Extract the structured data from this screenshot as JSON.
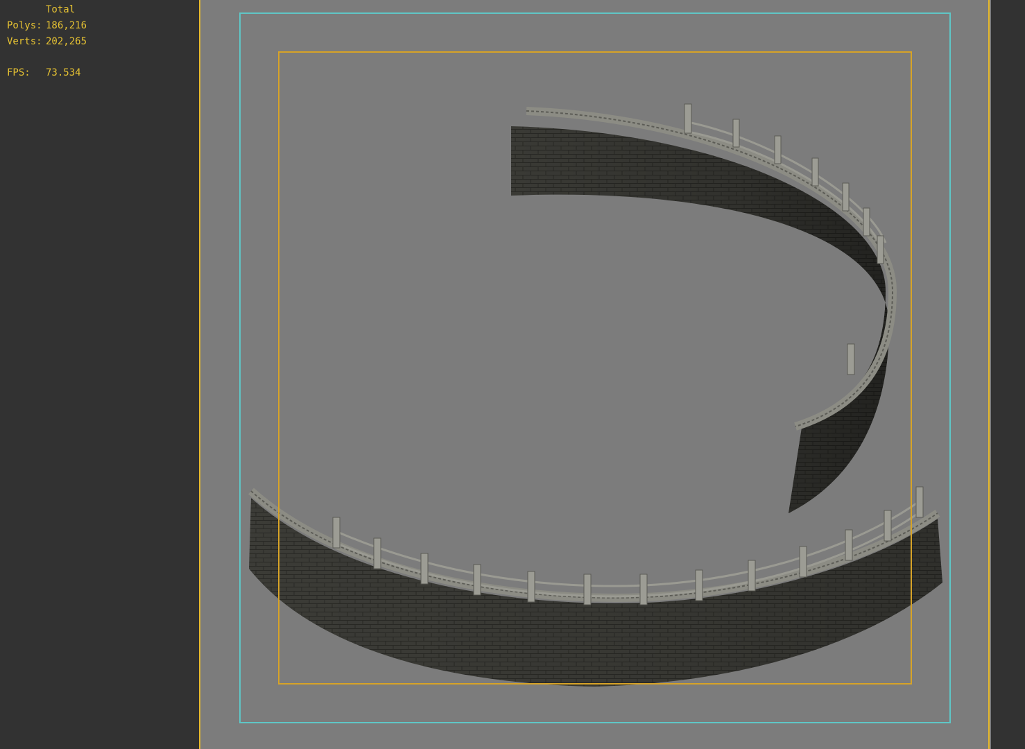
{
  "stats": {
    "header": "Total",
    "polys_label": "Polys:",
    "polys_value": "186,216",
    "verts_label": "Verts:",
    "verts_value": "202,265",
    "fps_label": "FPS:",
    "fps_value": "73.534"
  },
  "colors": {
    "stats_text": "#e6c232",
    "viewport_bg": "#7c7c7c",
    "panel_bg": "#323232",
    "safe_frame": "#5fc6c6",
    "action_frame": "#d7a327",
    "viewport_border": "#e6b82a"
  },
  "scene": {
    "objects": [
      "curved-brick-wall-upper",
      "curved-brick-wall-lower"
    ]
  }
}
